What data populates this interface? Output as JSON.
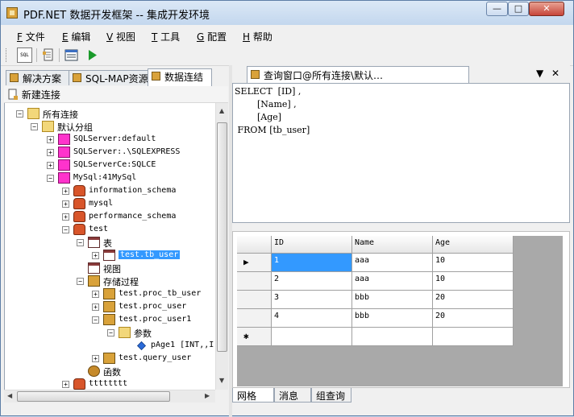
{
  "window": {
    "title": "PDF.NET 数据开发框架 -- 集成开发环境",
    "controls": {
      "minimize": "—",
      "maximize": "□",
      "close": "✕"
    }
  },
  "menu": [
    {
      "key": "F",
      "label": "文件"
    },
    {
      "key": "E",
      "label": "编辑"
    },
    {
      "key": "V",
      "label": "视图"
    },
    {
      "key": "T",
      "label": "工具"
    },
    {
      "key": "G",
      "label": "配置"
    },
    {
      "key": "H",
      "label": "帮助"
    }
  ],
  "toolbar": {
    "sql_icon_text": "SQL"
  },
  "left_tabs": [
    {
      "label": "解决方案"
    },
    {
      "label": "SQL-MAP资源"
    },
    {
      "label": "数据连结"
    }
  ],
  "left_toolbar": {
    "new_connection": "新建连接"
  },
  "tree": {
    "root": "所有连接",
    "group": "默认分组",
    "connections": [
      "SQLServer:default",
      "SQLServer:.\\SQLEXPRESS",
      "SQLServerCe:SQLCE",
      "MySql:41MySql"
    ],
    "schemas": [
      "information_schema",
      "mysql",
      "performance_schema",
      "test"
    ],
    "tables_label": "表",
    "selected_table": "test.tb_user",
    "views_label": "视图",
    "procs_label": "存储过程",
    "procs": [
      "test.proc_tb_user",
      "test.proc_user",
      "test.proc_user1"
    ],
    "params_label": "参数",
    "param": "pAge1 [INT,,I",
    "proc_after": "test.query_user",
    "funcs_label": "函数",
    "last_schema": "tttttttt"
  },
  "document": {
    "tab_title": "查询窗口@所有连接\\默认…",
    "ctl_dropdown": "▼",
    "ctl_close": "✕",
    "sql": [
      "SELECT  [ID] ,",
      "        [Name] ,",
      "        [Age]",
      " FROM [tb_user]"
    ]
  },
  "grid": {
    "columns": [
      "ID",
      "Name",
      "Age"
    ],
    "rows": [
      [
        "1",
        "aaa",
        "10"
      ],
      [
        "2",
        "aaa",
        "10"
      ],
      [
        "3",
        "bbb",
        "20"
      ],
      [
        "4",
        "bbb",
        "20"
      ]
    ],
    "current_marker": "▶",
    "new_row_marker": "✱"
  },
  "result_tabs": [
    "网格",
    "消息",
    "组查询"
  ],
  "colors": {
    "selection": "#3399ff",
    "tree_db": "#ff33cc",
    "run_green": "#1a9a2a"
  }
}
